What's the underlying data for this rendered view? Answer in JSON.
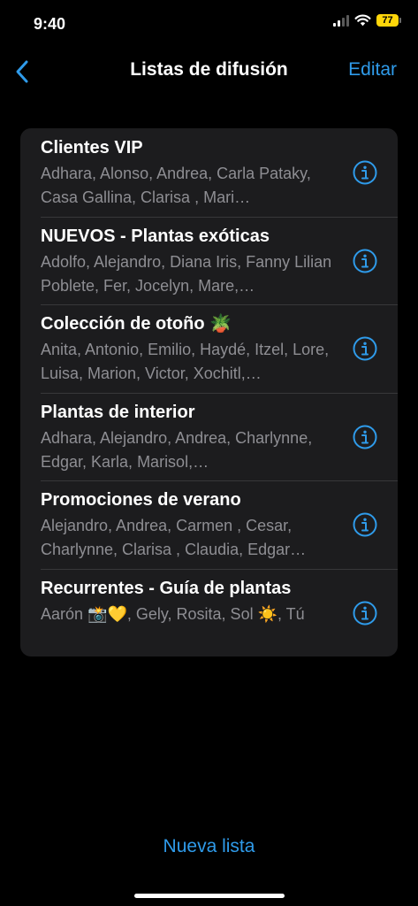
{
  "status_bar": {
    "time": "9:40",
    "battery": "77",
    "battery_color": "#ffd60a"
  },
  "nav": {
    "back_icon": "chevron-left-icon",
    "title": "Listas de difusión",
    "edit_label": "Editar"
  },
  "accent_color": "#2f9bea",
  "lists": [
    {
      "title": "Clientes VIP",
      "members": "Adhara, Alonso, Andrea, Carla Pataky, Casa Gallina, Clarisa , Mari…"
    },
    {
      "title": "NUEVOS - Plantas exóticas",
      "members": "Adolfo, Alejandro, Diana Iris, Fanny Lilian Poblete, Fer, Jocelyn, Mare,…"
    },
    {
      "title": "Colección de otoño 🪴",
      "members": "Anita, Antonio, Emilio, Haydé, Itzel, Lore, Luisa, Marion, Victor, Xochitl,…"
    },
    {
      "title": "Plantas de interior",
      "members": "Adhara, Alejandro, Andrea, Charlynne, Edgar, Karla, Marisol,…"
    },
    {
      "title": "Promociones de verano",
      "members": "Alejandro, Andrea, Carmen , Cesar, Charlynne, Clarisa , Claudia, Edgar…"
    },
    {
      "title": "Recurrentes - Guía de plantas",
      "members": "Aarón 📸💛, Gely, Rosita, Sol ☀️, Tú"
    }
  ],
  "info_icon": "info-circle-icon",
  "footer": {
    "new_list_label": "Nueva lista"
  }
}
